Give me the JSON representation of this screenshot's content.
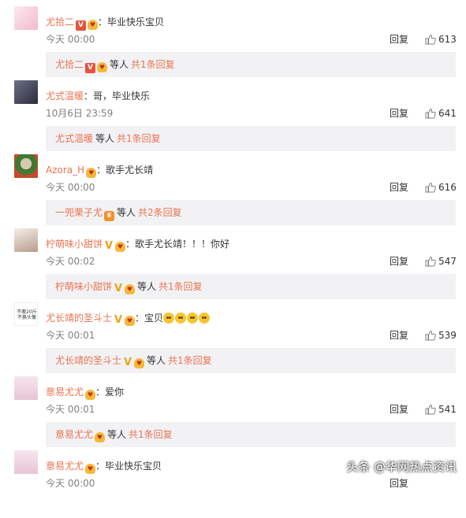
{
  "reply_button_label": "回复",
  "comments": [
    {
      "avatar_text": "",
      "username": "尤拾二",
      "badges": [
        "badge-v",
        "badge-fan"
      ],
      "text": "：毕业快乐宝贝",
      "time": "今天 00:00",
      "likes": "613",
      "reply_box": {
        "username": "尤拾二",
        "badges": [
          "badge-v",
          "badge-fan"
        ],
        "suffix": "等人",
        "more": "共1条回复"
      }
    },
    {
      "avatar_text": "",
      "username": "尤式温暖",
      "badges": [],
      "text": "：哥，毕业快乐",
      "time": "10月6日 23:59",
      "likes": "641",
      "reply_box": {
        "username": "尤式温暖",
        "badges": [],
        "suffix": "等人",
        "more": "共1条回复"
      }
    },
    {
      "avatar_text": "",
      "username": "Azora_H",
      "badges": [
        "badge-fan"
      ],
      "text": "：歌手尤长靖",
      "time": "今天 00:00",
      "likes": "616",
      "reply_box": {
        "username": "一兜栗子尤",
        "badges": [
          "badge-crown"
        ],
        "suffix": "等人",
        "more": "共2条回复"
      }
    },
    {
      "avatar_text": "",
      "username": "柠萌味小甜饼",
      "badges": [
        "badge-vy",
        "badge-fan"
      ],
      "text": "：歌手尤长靖！！！你好",
      "time": "今天 00:02",
      "likes": "547",
      "reply_box": {
        "username": "柠萌味小甜饼",
        "badges": [
          "badge-vy",
          "badge-fan"
        ],
        "suffix": "等人",
        "more": "共1条回复"
      }
    },
    {
      "avatar_text": "不瘦20斤 不换头像",
      "username": "尤长靖的圣斗士",
      "badges": [
        "badge-vy",
        "badge-fan"
      ],
      "text": "：宝贝",
      "emoji_count": 4,
      "time": "今天 00:01",
      "likes": "539",
      "reply_box": {
        "username": "尤长靖的圣斗士",
        "badges": [
          "badge-vy",
          "badge-fan"
        ],
        "suffix": "等人",
        "more": "共1条回复"
      }
    },
    {
      "avatar_text": "",
      "username": "意易尤尤",
      "badges": [
        "badge-fan"
      ],
      "text": "：爱你",
      "time": "今天 00:01",
      "likes": "541",
      "reply_box": {
        "username": "意易尤尤",
        "badges": [
          "badge-fan"
        ],
        "suffix": "等人",
        "more": "共1条回复"
      }
    },
    {
      "avatar_text": "",
      "username": "意易尤尤",
      "badges": [
        "badge-fan"
      ],
      "text": "：毕业快乐宝贝",
      "time": "今天 00:00",
      "likes": "",
      "reply_box": null
    }
  ],
  "badge_glyphs": {
    "badge-v": "V",
    "badge-vy": "V",
    "badge-fan": "♥",
    "badge-crown": "♛"
  },
  "watermark": "头条 @华网热点资讯"
}
